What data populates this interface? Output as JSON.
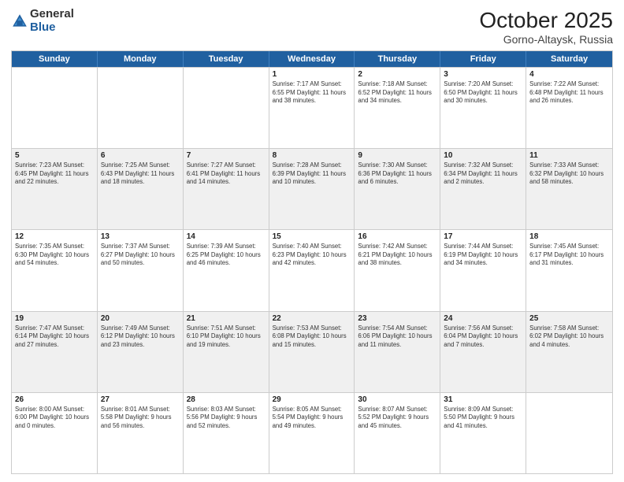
{
  "header": {
    "logo_general": "General",
    "logo_blue": "Blue",
    "month_title": "October 2025",
    "location": "Gorno-Altaysk, Russia"
  },
  "weekdays": [
    "Sunday",
    "Monday",
    "Tuesday",
    "Wednesday",
    "Thursday",
    "Friday",
    "Saturday"
  ],
  "rows": [
    [
      {
        "date": "",
        "info": ""
      },
      {
        "date": "",
        "info": ""
      },
      {
        "date": "",
        "info": ""
      },
      {
        "date": "1",
        "info": "Sunrise: 7:17 AM\nSunset: 6:55 PM\nDaylight: 11 hours and 38 minutes."
      },
      {
        "date": "2",
        "info": "Sunrise: 7:18 AM\nSunset: 6:52 PM\nDaylight: 11 hours and 34 minutes."
      },
      {
        "date": "3",
        "info": "Sunrise: 7:20 AM\nSunset: 6:50 PM\nDaylight: 11 hours and 30 minutes."
      },
      {
        "date": "4",
        "info": "Sunrise: 7:22 AM\nSunset: 6:48 PM\nDaylight: 11 hours and 26 minutes."
      }
    ],
    [
      {
        "date": "5",
        "info": "Sunrise: 7:23 AM\nSunset: 6:45 PM\nDaylight: 11 hours and 22 minutes."
      },
      {
        "date": "6",
        "info": "Sunrise: 7:25 AM\nSunset: 6:43 PM\nDaylight: 11 hours and 18 minutes."
      },
      {
        "date": "7",
        "info": "Sunrise: 7:27 AM\nSunset: 6:41 PM\nDaylight: 11 hours and 14 minutes."
      },
      {
        "date": "8",
        "info": "Sunrise: 7:28 AM\nSunset: 6:39 PM\nDaylight: 11 hours and 10 minutes."
      },
      {
        "date": "9",
        "info": "Sunrise: 7:30 AM\nSunset: 6:36 PM\nDaylight: 11 hours and 6 minutes."
      },
      {
        "date": "10",
        "info": "Sunrise: 7:32 AM\nSunset: 6:34 PM\nDaylight: 11 hours and 2 minutes."
      },
      {
        "date": "11",
        "info": "Sunrise: 7:33 AM\nSunset: 6:32 PM\nDaylight: 10 hours and 58 minutes."
      }
    ],
    [
      {
        "date": "12",
        "info": "Sunrise: 7:35 AM\nSunset: 6:30 PM\nDaylight: 10 hours and 54 minutes."
      },
      {
        "date": "13",
        "info": "Sunrise: 7:37 AM\nSunset: 6:27 PM\nDaylight: 10 hours and 50 minutes."
      },
      {
        "date": "14",
        "info": "Sunrise: 7:39 AM\nSunset: 6:25 PM\nDaylight: 10 hours and 46 minutes."
      },
      {
        "date": "15",
        "info": "Sunrise: 7:40 AM\nSunset: 6:23 PM\nDaylight: 10 hours and 42 minutes."
      },
      {
        "date": "16",
        "info": "Sunrise: 7:42 AM\nSunset: 6:21 PM\nDaylight: 10 hours and 38 minutes."
      },
      {
        "date": "17",
        "info": "Sunrise: 7:44 AM\nSunset: 6:19 PM\nDaylight: 10 hours and 34 minutes."
      },
      {
        "date": "18",
        "info": "Sunrise: 7:45 AM\nSunset: 6:17 PM\nDaylight: 10 hours and 31 minutes."
      }
    ],
    [
      {
        "date": "19",
        "info": "Sunrise: 7:47 AM\nSunset: 6:14 PM\nDaylight: 10 hours and 27 minutes."
      },
      {
        "date": "20",
        "info": "Sunrise: 7:49 AM\nSunset: 6:12 PM\nDaylight: 10 hours and 23 minutes."
      },
      {
        "date": "21",
        "info": "Sunrise: 7:51 AM\nSunset: 6:10 PM\nDaylight: 10 hours and 19 minutes."
      },
      {
        "date": "22",
        "info": "Sunrise: 7:53 AM\nSunset: 6:08 PM\nDaylight: 10 hours and 15 minutes."
      },
      {
        "date": "23",
        "info": "Sunrise: 7:54 AM\nSunset: 6:06 PM\nDaylight: 10 hours and 11 minutes."
      },
      {
        "date": "24",
        "info": "Sunrise: 7:56 AM\nSunset: 6:04 PM\nDaylight: 10 hours and 7 minutes."
      },
      {
        "date": "25",
        "info": "Sunrise: 7:58 AM\nSunset: 6:02 PM\nDaylight: 10 hours and 4 minutes."
      }
    ],
    [
      {
        "date": "26",
        "info": "Sunrise: 8:00 AM\nSunset: 6:00 PM\nDaylight: 10 hours and 0 minutes."
      },
      {
        "date": "27",
        "info": "Sunrise: 8:01 AM\nSunset: 5:58 PM\nDaylight: 9 hours and 56 minutes."
      },
      {
        "date": "28",
        "info": "Sunrise: 8:03 AM\nSunset: 5:56 PM\nDaylight: 9 hours and 52 minutes."
      },
      {
        "date": "29",
        "info": "Sunrise: 8:05 AM\nSunset: 5:54 PM\nDaylight: 9 hours and 49 minutes."
      },
      {
        "date": "30",
        "info": "Sunrise: 8:07 AM\nSunset: 5:52 PM\nDaylight: 9 hours and 45 minutes."
      },
      {
        "date": "31",
        "info": "Sunrise: 8:09 AM\nSunset: 5:50 PM\nDaylight: 9 hours and 41 minutes."
      },
      {
        "date": "",
        "info": ""
      }
    ]
  ]
}
